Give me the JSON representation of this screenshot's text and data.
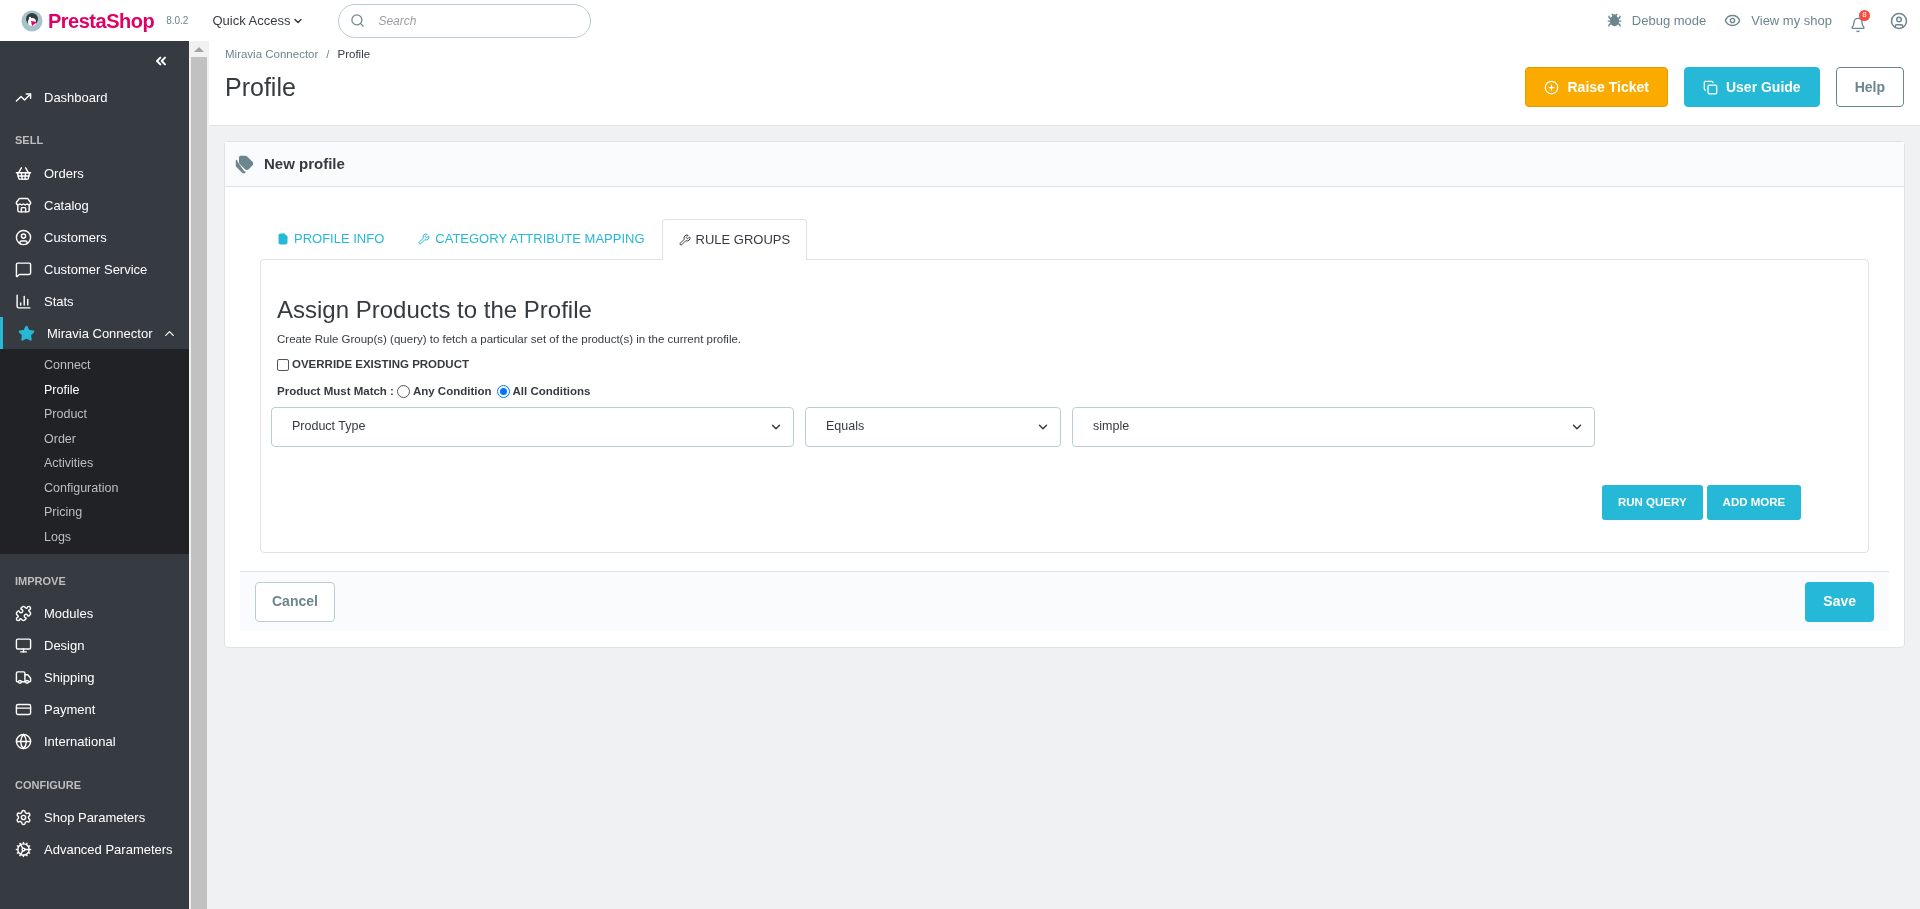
{
  "header": {
    "logo": "PrestaShop",
    "version": "8.0.2",
    "quick_access": "Quick Access",
    "search": {
      "placeholder": "Search"
    },
    "debug_mode": "Debug mode",
    "view_shop": "View my shop",
    "notification_count": "8"
  },
  "sidebar": {
    "top": [
      {
        "label": "Dashboard",
        "selected": false
      }
    ],
    "sections": [
      {
        "title": "SELL",
        "items": [
          {
            "label": "Orders",
            "selected": false
          },
          {
            "label": "Catalog",
            "selected": false
          },
          {
            "label": "Customers",
            "selected": false
          },
          {
            "label": "Customer Service",
            "selected": false
          },
          {
            "label": "Stats",
            "selected": false
          },
          {
            "label": "Miravia Connector",
            "selected": true,
            "expanded": true,
            "children": [
              {
                "label": "Connect",
                "selected": false
              },
              {
                "label": "Profile",
                "selected": true
              },
              {
                "label": "Product",
                "selected": false
              },
              {
                "label": "Order",
                "selected": false
              },
              {
                "label": "Activities",
                "selected": false
              },
              {
                "label": "Configuration",
                "selected": false
              },
              {
                "label": "Pricing",
                "selected": false
              },
              {
                "label": "Logs",
                "selected": false
              }
            ]
          }
        ]
      },
      {
        "title": "IMPROVE",
        "items": [
          {
            "label": "Modules",
            "selected": false
          },
          {
            "label": "Design",
            "selected": false
          },
          {
            "label": "Shipping",
            "selected": false
          },
          {
            "label": "Payment",
            "selected": false
          },
          {
            "label": "International",
            "selected": false
          }
        ]
      },
      {
        "title": "CONFIGURE",
        "items": [
          {
            "label": "Shop Parameters",
            "selected": false
          },
          {
            "label": "Advanced Parameters",
            "selected": false
          }
        ]
      }
    ]
  },
  "page": {
    "breadcrumb": [
      "Miravia Connector",
      "Profile"
    ],
    "breadcrumb_separator": "/",
    "title": "Profile",
    "actions": [
      {
        "label": "Raise Ticket",
        "kind": "warning"
      },
      {
        "label": "User Guide",
        "kind": "info"
      },
      {
        "label": "Help",
        "kind": "outline"
      }
    ]
  },
  "card": {
    "title": "New profile",
    "tabs": [
      {
        "label": "PROFILE INFO",
        "selected": false
      },
      {
        "label": "CATEGORY ATTRIBUTE MAPPING",
        "selected": false
      },
      {
        "label": "RULE GROUPS",
        "selected": true
      }
    ],
    "panel": {
      "heading": "Assign Products to the Profile",
      "description": "Create Rule Group(s) (query) to fetch a particular set of the product(s) in the current profile.",
      "override": {
        "label": "OVERRIDE EXISTING PRODUCT",
        "checked": false
      },
      "match": {
        "label": "Product Must Match :",
        "options": [
          {
            "label": "Any Condition",
            "selected": false
          },
          {
            "label": "All Conditions",
            "selected": true
          }
        ]
      },
      "rule": [
        {
          "value": "Product Type"
        },
        {
          "value": "Equals"
        },
        {
          "value": "simple"
        }
      ],
      "buttons": [
        "RUN QUERY",
        "ADD MORE"
      ]
    },
    "footer": {
      "cancel": "Cancel",
      "save": "Save"
    }
  }
}
